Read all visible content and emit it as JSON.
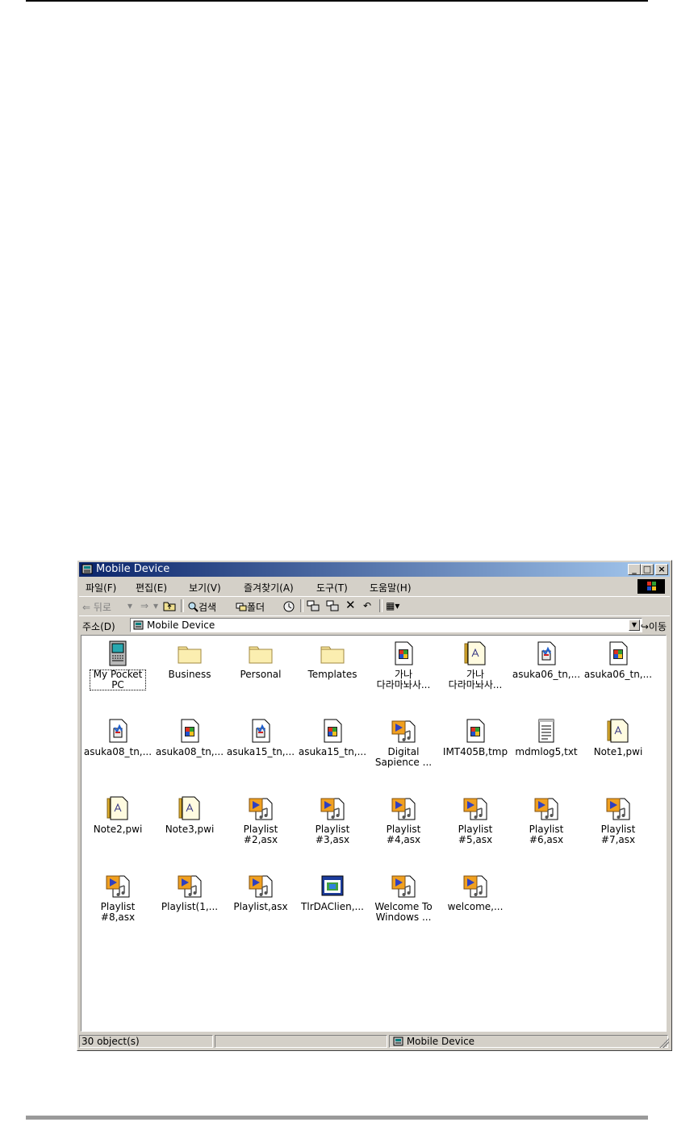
{
  "window": {
    "title": "Mobile Device",
    "controls": {
      "minimize": "_",
      "maximize": "□",
      "close": "×"
    }
  },
  "menu": {
    "items": [
      "파일(F)",
      "편집(E)",
      "보기(V)",
      "즐겨찾기(A)",
      "도구(T)",
      "도움말(H)"
    ]
  },
  "toolbar": {
    "back": "⇐ 뒤로",
    "forward": "⇒",
    "search": "검색",
    "folders": "폴더",
    "views": "▦▾"
  },
  "address": {
    "label": "주소(D)",
    "value": "Mobile Device",
    "go": "이동"
  },
  "items": [
    {
      "label": "My Pocket\nPC",
      "icon": "pocket-pc-icon"
    },
    {
      "label": "Business",
      "icon": "folder-icon"
    },
    {
      "label": "Personal",
      "icon": "folder-icon"
    },
    {
      "label": "Templates",
      "icon": "folder-icon"
    },
    {
      "label": "가나\n다라마놔사...",
      "icon": "media-file-icon"
    },
    {
      "label": "가나\n다라마놔사...",
      "icon": "note-file-icon"
    },
    {
      "label": "asuka06_tn,...",
      "icon": "image-file-icon"
    },
    {
      "label": "asuka06_tn,...",
      "icon": "media-file-icon"
    },
    {
      "label": "asuka08_tn,...",
      "icon": "image-file-icon"
    },
    {
      "label": "asuka08_tn,...",
      "icon": "media-file-icon"
    },
    {
      "label": "asuka15_tn,...",
      "icon": "image-file-icon"
    },
    {
      "label": "asuka15_tn,...",
      "icon": "media-file-icon"
    },
    {
      "label": "Digital\nSapience ...",
      "icon": "playlist-icon"
    },
    {
      "label": "IMT405B,tmp",
      "icon": "media-file-icon"
    },
    {
      "label": "mdmlog5,txt",
      "icon": "text-file-icon"
    },
    {
      "label": "Note1,pwi",
      "icon": "note-file-icon"
    },
    {
      "label": "Note2,pwi",
      "icon": "note-file-icon"
    },
    {
      "label": "Note3,pwi",
      "icon": "note-file-icon"
    },
    {
      "label": "Playlist\n#2,asx",
      "icon": "playlist-icon"
    },
    {
      "label": "Playlist\n#3,asx",
      "icon": "playlist-icon"
    },
    {
      "label": "Playlist\n#4,asx",
      "icon": "playlist-icon"
    },
    {
      "label": "Playlist\n#5,asx",
      "icon": "playlist-icon"
    },
    {
      "label": "Playlist\n#6,asx",
      "icon": "playlist-icon"
    },
    {
      "label": "Playlist\n#7,asx",
      "icon": "playlist-icon"
    },
    {
      "label": "Playlist\n#8,asx",
      "icon": "playlist-icon"
    },
    {
      "label": "Playlist(1,...",
      "icon": "playlist-icon"
    },
    {
      "label": "Playlist,asx",
      "icon": "playlist-icon"
    },
    {
      "label": "TlrDAClien,...",
      "icon": "app-icon"
    },
    {
      "label": "Welcome To\nWindows ...",
      "icon": "playlist-icon"
    },
    {
      "label": "welcome,...",
      "icon": "playlist-icon"
    }
  ],
  "status": {
    "count": "30 object(s)",
    "location": "Mobile Device"
  }
}
